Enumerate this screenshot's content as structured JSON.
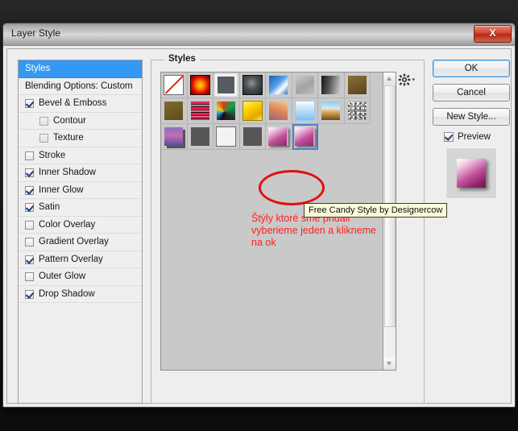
{
  "window": {
    "title": "Layer Style",
    "close_label": "X"
  },
  "sidebar": {
    "items": [
      {
        "label": "Styles",
        "type": "header",
        "checked": null
      },
      {
        "label": "Blending Options: Custom",
        "type": "plain",
        "checked": null
      },
      {
        "label": "Bevel & Emboss",
        "type": "check",
        "checked": true
      },
      {
        "label": "Contour",
        "type": "sub",
        "checked": false
      },
      {
        "label": "Texture",
        "type": "sub",
        "checked": false
      },
      {
        "label": "Stroke",
        "type": "check",
        "checked": false
      },
      {
        "label": "Inner Shadow",
        "type": "check",
        "checked": true
      },
      {
        "label": "Inner Glow",
        "type": "check",
        "checked": true
      },
      {
        "label": "Satin",
        "type": "check",
        "checked": true
      },
      {
        "label": "Color Overlay",
        "type": "check",
        "checked": false
      },
      {
        "label": "Gradient Overlay",
        "type": "check",
        "checked": false
      },
      {
        "label": "Pattern Overlay",
        "type": "check",
        "checked": true
      },
      {
        "label": "Outer Glow",
        "type": "check",
        "checked": false
      },
      {
        "label": "Drop Shadow",
        "type": "check",
        "checked": true
      }
    ]
  },
  "styles_panel": {
    "legend": "Styles",
    "swatches": [
      {
        "name": "none",
        "class": "s-none",
        "selected": false
      },
      {
        "name": "red-glow",
        "class": "s-redglow",
        "selected": false
      },
      {
        "name": "gray-glow",
        "class": "s-grayglow",
        "selected": false
      },
      {
        "name": "dark-emboss",
        "class": "s-darkemb",
        "selected": false
      },
      {
        "name": "blue-gloss",
        "class": "s-blue",
        "selected": false
      },
      {
        "name": "light-gray",
        "class": "s-lgray",
        "selected": false
      },
      {
        "name": "dark-gradient",
        "class": "s-darkgrad",
        "selected": false
      },
      {
        "name": "brown",
        "class": "s-brown",
        "selected": false
      },
      {
        "name": "olive",
        "class": "s-olive",
        "selected": false
      },
      {
        "name": "red-stripes",
        "class": "s-stripes",
        "selected": false
      },
      {
        "name": "abstract-color",
        "class": "s-abstract",
        "selected": false
      },
      {
        "name": "yellow-gloss",
        "class": "s-yellow",
        "selected": false
      },
      {
        "name": "tan-gradient",
        "class": "s-tan",
        "selected": false
      },
      {
        "name": "light-blue",
        "class": "s-ltblue",
        "selected": false
      },
      {
        "name": "sky-landscape",
        "class": "s-sky",
        "selected": false
      },
      {
        "name": "noise-texture",
        "class": "s-noise",
        "selected": false
      },
      {
        "name": "purple-block",
        "class": "s-purple",
        "selected": false
      },
      {
        "name": "dark-gray",
        "class": "s-dgray",
        "selected": false
      },
      {
        "name": "white-outline",
        "class": "s-white",
        "selected": false
      },
      {
        "name": "dark-gray-2",
        "class": "s-dgray",
        "selected": false
      },
      {
        "name": "candy-pink-1",
        "class": "s-candy",
        "selected": false
      },
      {
        "name": "candy-pink-2",
        "class": "s-candy",
        "selected": true
      }
    ],
    "gear_label": "gear-icon"
  },
  "buttons": {
    "ok": "OK",
    "cancel": "Cancel",
    "new_style": "New Style...",
    "preview": "Preview"
  },
  "annotations": {
    "tooltip": "Free Candy Style by Designercow",
    "note": "Štýly ktoré sme pridali\nvyberieme jeden a klikneme\nna ok"
  },
  "colors": {
    "accent_blue": "#3399f3",
    "selection_blue": "#4f7fd0",
    "annotation_red": "#ff1f1f",
    "ellipse_red": "#e01010",
    "tooltip_bg": "#fdfbd8",
    "close_red": "#b62a17"
  }
}
